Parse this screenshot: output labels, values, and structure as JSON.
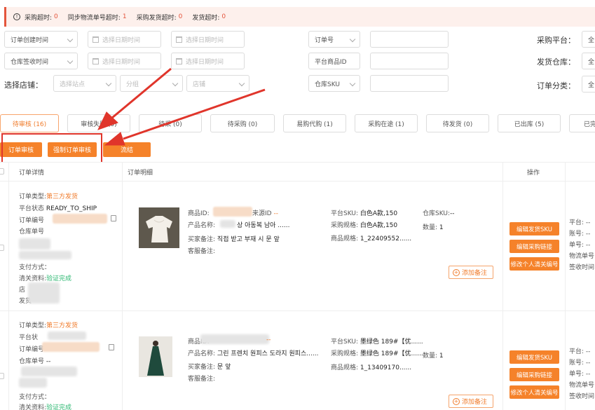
{
  "alert": {
    "icon": "info-circle-icon",
    "items": [
      {
        "label": "采购超时:",
        "value": "0"
      },
      {
        "label": "同步物流单号超时:",
        "value": "1"
      },
      {
        "label": "采购发货超时:",
        "value": "0"
      },
      {
        "label": "发货超时:",
        "value": "0"
      }
    ]
  },
  "filters": {
    "order_created_time": "订单创建时间",
    "warehouse_received_time": "仓库签收时间",
    "date_placeholder": "选择日期时间",
    "order_no": "订单号",
    "platform_product_id": "平台商品ID",
    "warehouse_sku": "仓库SKU",
    "purchase_platform_label": "采购平台：",
    "purchase_platform_value": "全",
    "ship_warehouse_label": "发货仓库：",
    "ship_warehouse_value": "全",
    "order_category_label": "订单分类：",
    "order_category_value": "全",
    "select_store_label": "选择店铺：",
    "site_placeholder": "选择站点",
    "group_placeholder": "分组",
    "store_placeholder": "店铺"
  },
  "tabs": [
    {
      "label": "待审核 (16)"
    },
    {
      "label": "审核失败 (0)"
    },
    {
      "label": "待采 (0)"
    },
    {
      "label": "待采购 (0)"
    },
    {
      "label": "易购代购 (1)"
    },
    {
      "label": "采购在途 (1)"
    },
    {
      "label": "待发货 (0)"
    },
    {
      "label": "已出库 (5)"
    },
    {
      "label": "已完"
    }
  ],
  "actions": {
    "audit": "订单审核",
    "force_audit": "强制订单审核",
    "merge": "流结"
  },
  "table": {
    "col_order_detail": "订单详情",
    "col_order_items": "订单明细",
    "col_ops": "操作"
  },
  "labels": {
    "order_type": "订单类型:",
    "platform_status": "平台状态",
    "order_no": "订单编号",
    "warehouse_order_no": "仓库单号",
    "pay_method": "支付方式：",
    "customs_info": "清关资料:",
    "verified": "验证完成",
    "store": "店",
    "ship": "发货",
    "product_id": "商品ID:",
    "source_id": "来源ID",
    "product_name": "产品名称:",
    "buyer_note": "买家备注:",
    "service_note": "客服备注:",
    "platform_sku": "平台SKU:",
    "purchase_spec": "采购规格:",
    "product_spec": "商品规格:",
    "warehouse_sku": "仓库SKU:",
    "quantity": "数量:",
    "add_note": "添加备注",
    "btn_edit_sku": "编辑发货SKU",
    "btn_edit_link": "编辑采购链接",
    "btn_edit_customs": "修改个人清关编号",
    "right_platform": "平台: --",
    "right_account": "账号: --",
    "right_no": "单号: --",
    "right_logistics": "物流单号",
    "right_receive": "签收时间"
  },
  "orders": [
    {
      "order_type": "第三方发货",
      "platform_status": "READY_TO_SHIP",
      "dash": "--",
      "product_name": "상 아동복 남아 ......",
      "buyer_note": "직접 받고 부재 시 문 앞",
      "platform_sku": "白色A款,150",
      "purchase_spec": "白色A款,150",
      "product_spec": "1_22409552......",
      "warehouse_sku": "--",
      "quantity": "1"
    },
    {
      "order_type": "第三方发货",
      "platform_status": "平台状",
      "dash": "--",
      "product_name": "그린 프렌치 원피스 도라지 원피스......",
      "buyer_note": "문 앞",
      "platform_sku": "墨绿色 189#【优......",
      "purchase_spec": "墨绿色 189#【优......",
      "product_spec": "1_13409170......",
      "warehouse_sku": "",
      "quantity": "1",
      "warehouse_no_value": "--",
      "customs_value": "验证完成"
    }
  ]
}
